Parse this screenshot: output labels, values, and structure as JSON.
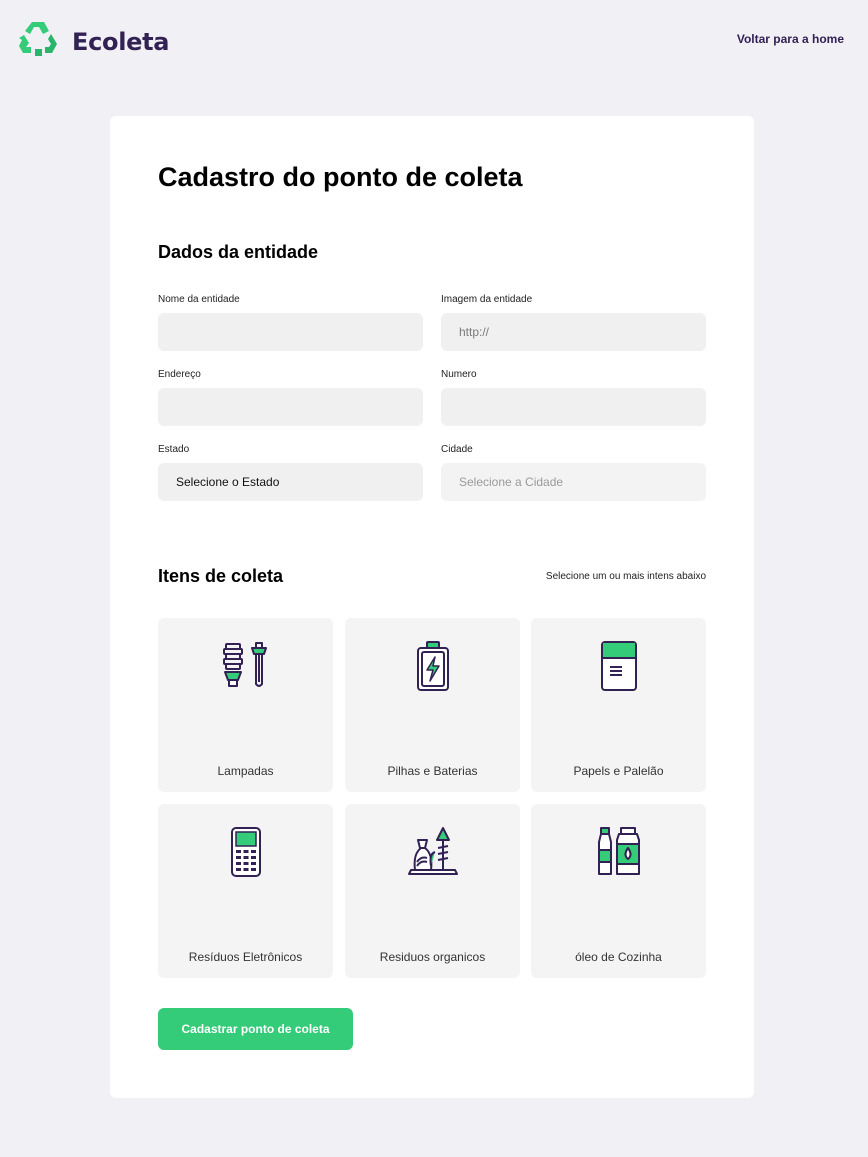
{
  "header": {
    "brand": "Ecoleta",
    "logo_icon": "recycle-icon",
    "back_link": "Voltar para a home"
  },
  "form": {
    "title": "Cadastro do ponto de coleta",
    "entity_section": {
      "title": "Dados da entidade",
      "fields": {
        "name": {
          "label": "Nome da entidade",
          "value": "",
          "placeholder": ""
        },
        "image": {
          "label": "Imagem da entidade",
          "value": "",
          "placeholder": "http://"
        },
        "address": {
          "label": "Endereço",
          "value": "",
          "placeholder": ""
        },
        "number": {
          "label": "Numero",
          "value": "",
          "placeholder": ""
        },
        "state": {
          "label": "Estado",
          "selected": "Selecione o Estado"
        },
        "city": {
          "label": "Cidade",
          "selected": "Selecione a Cidade"
        }
      }
    },
    "items_section": {
      "title": "Itens de coleta",
      "hint": "Selecione um ou mais intens abaixo",
      "items": [
        {
          "label": "Lampadas",
          "icon": "lamp-icon"
        },
        {
          "label": "Pilhas e Baterias",
          "icon": "battery-icon"
        },
        {
          "label": "Papels e Palelão",
          "icon": "paper-icon"
        },
        {
          "label": "Resíduos Eletrônicos",
          "icon": "electronics-icon"
        },
        {
          "label": "Residuos organicos",
          "icon": "organic-icon"
        },
        {
          "label": "óleo de Cozinha",
          "icon": "cooking-oil-icon"
        }
      ]
    },
    "submit_label": "Cadastrar ponto de coleta"
  },
  "colors": {
    "background": "#F0F0F5",
    "primary": "#34CB79",
    "title": "#322153",
    "card": "#FFFFFF",
    "input": "#F0F0F0"
  }
}
